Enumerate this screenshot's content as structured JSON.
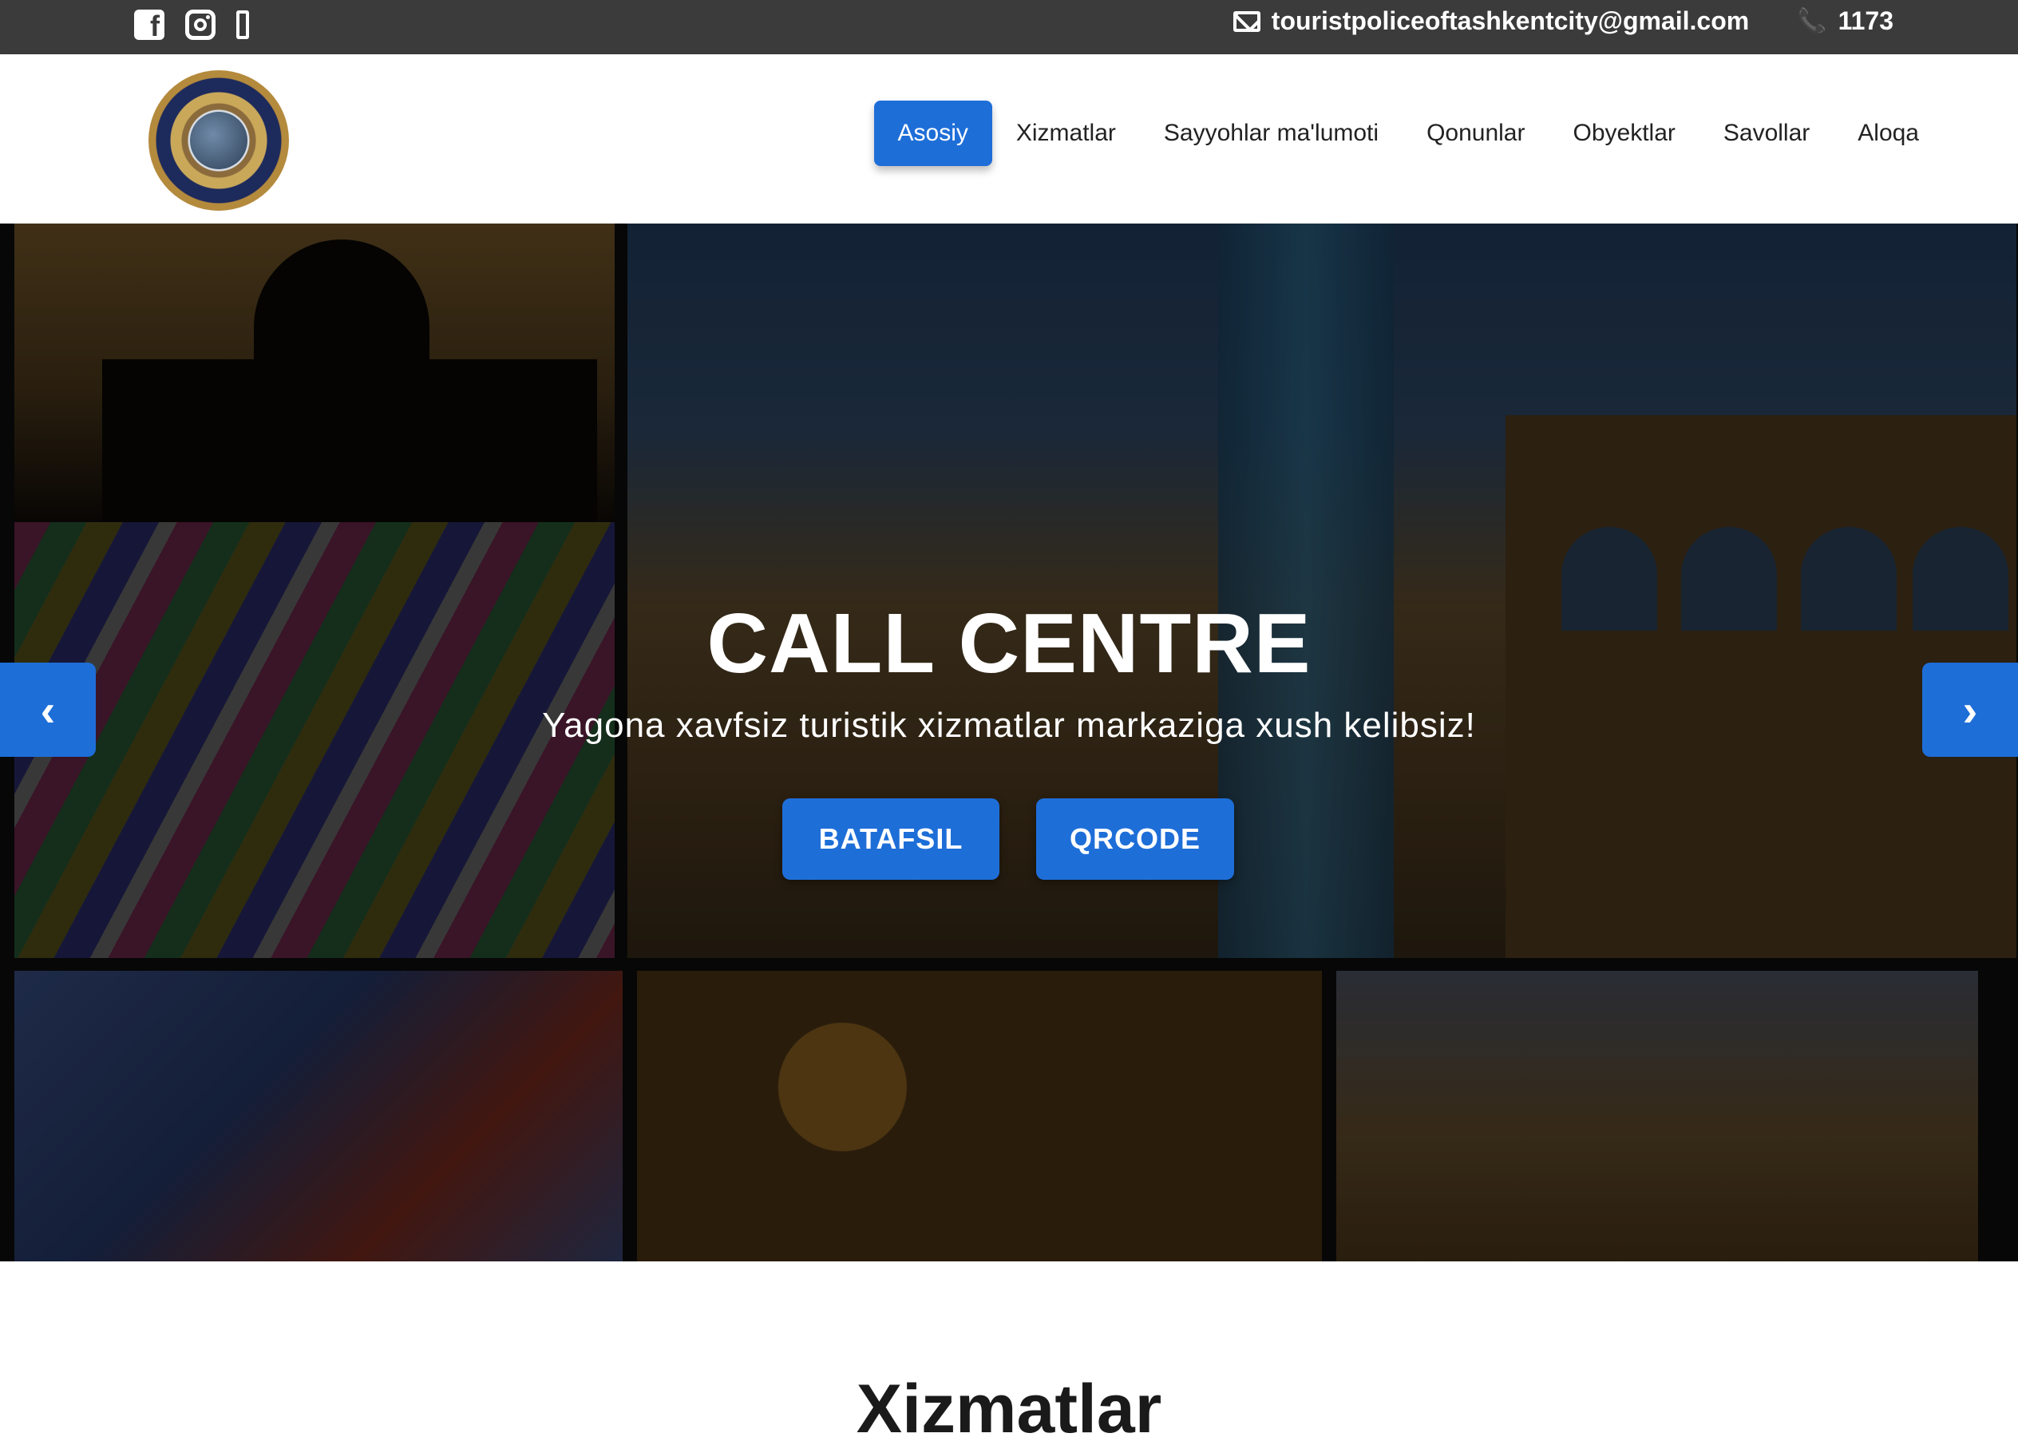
{
  "topbar": {
    "social_icons": [
      "facebook-icon",
      "instagram-icon",
      "mobile-phone-icon"
    ],
    "email": "touristpoliceoftashkentcity@gmail.com",
    "phone": "1173"
  },
  "header": {
    "logo_alt_text": "TOURIST POLICE",
    "nav": [
      {
        "label": "Asosiy",
        "active": true
      },
      {
        "label": "Xizmatlar",
        "active": false
      },
      {
        "label": "Sayyohlar ma'lumoti",
        "active": false
      },
      {
        "label": "Qonunlar",
        "active": false
      },
      {
        "label": "Obyektlar",
        "active": false
      },
      {
        "label": "Savollar",
        "active": false
      },
      {
        "label": "Aloqa",
        "active": false
      }
    ]
  },
  "hero": {
    "title": "CALL CENTRE",
    "subtitle": "Yagona xavfsiz turistik xizmatlar markaziga xush kelibsiz!",
    "buttons": {
      "primary": "BATAFSIL",
      "secondary": "QRCODE"
    },
    "prev_arrow": "‹",
    "next_arrow": "›"
  },
  "section": {
    "title": "Xizmatlar"
  },
  "colors": {
    "topbar_bg": "#3b3b3b",
    "accent": "#1e6ed8",
    "nav_text": "#222222",
    "hero_overlay": "rgba(0,0,0,0.28)"
  }
}
